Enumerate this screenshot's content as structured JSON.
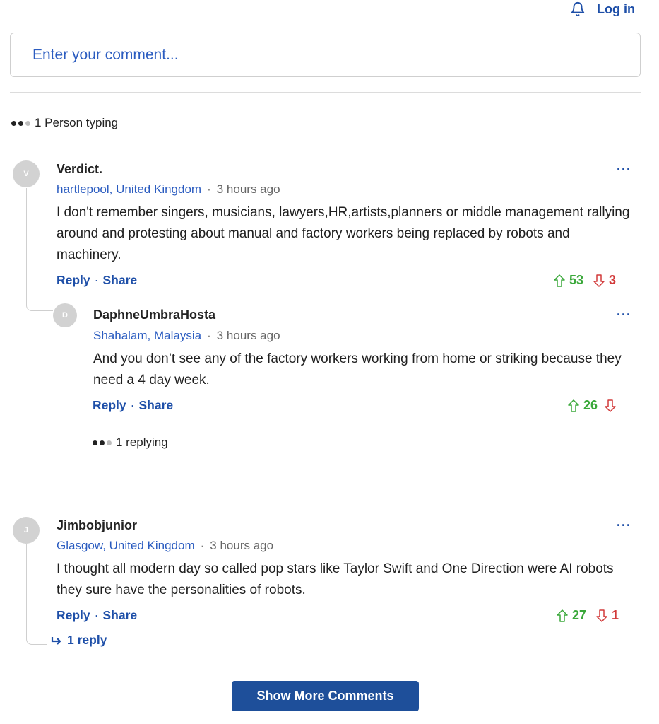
{
  "header": {
    "login_label": "Log in"
  },
  "comment_input": {
    "placeholder": "Enter your comment..."
  },
  "typing_indicator": {
    "text": "1 Person typing"
  },
  "comments": [
    {
      "avatar_initial": "V",
      "username": "Verdict.",
      "location": "hartlepool, United Kingdom",
      "time": "3 hours ago",
      "text": "I don't remember singers, musicians, lawyers,HR,artists,planners or middle management rallying around and protesting about manual and factory workers being replaced by robots and machinery.",
      "reply_label": "Reply",
      "share_label": "Share",
      "separator": "·",
      "upvotes": "53",
      "downvotes": "3",
      "replies": [
        {
          "avatar_initial": "D",
          "username": "DaphneUmbraHosta",
          "location": "Shahalam, Malaysia",
          "time": "3 hours ago",
          "text": "And you don’t see any of the factory workers working from home or striking because they need a 4 day week.",
          "reply_label": "Reply",
          "share_label": "Share",
          "separator": "·",
          "upvotes": "26",
          "downvotes": ""
        }
      ],
      "replying_text": "1 replying"
    },
    {
      "avatar_initial": "J",
      "username": "Jimbobjunior",
      "location": "Glasgow, United Kingdom",
      "time": "3 hours ago",
      "text": "I thought all modern day so called pop stars like Taylor Swift and One Direction were AI robots they sure have the personalities of robots.",
      "reply_label": "Reply",
      "share_label": "Share",
      "separator": "·",
      "upvotes": "27",
      "downvotes": "1",
      "replies_toggle": "1 reply"
    }
  ],
  "show_more_label": "Show More Comments",
  "more_menu_label": "···",
  "meta_separator": "·",
  "colors": {
    "link_blue": "#1e4fa8",
    "upvote_green": "#3aa83a",
    "downvote_red": "#d23a3a",
    "button_blue": "#1e4f9a"
  },
  "icons": {
    "bell": "bell-icon",
    "upvote": "arrow-up-icon",
    "downvote": "arrow-down-icon",
    "reply_arrow": "reply-arrow-icon"
  }
}
